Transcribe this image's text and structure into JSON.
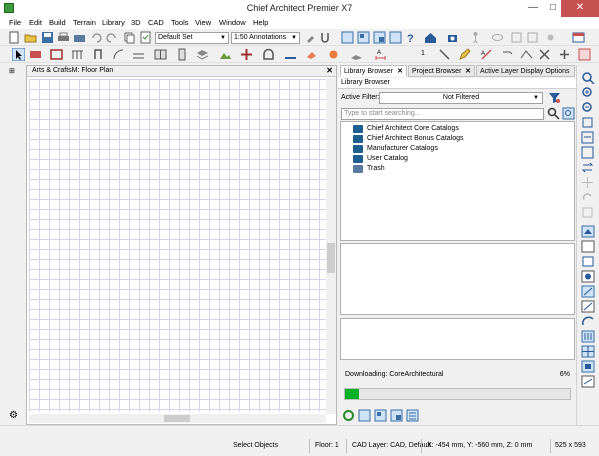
{
  "window": {
    "title": "Chief Architect Premier X7",
    "minimize": "—",
    "maximize": "□",
    "close": "✕"
  },
  "menu": [
    "File",
    "Edit",
    "Build",
    "Terrain",
    "Library",
    "3D",
    "CAD",
    "Tools",
    "View",
    "Window",
    "Help"
  ],
  "toolbar": {
    "layer_set": "Default Set",
    "annotation_set": "1:50 Annotations",
    "number_field": "1"
  },
  "plan_view": {
    "title": "Arts & CraftsM: Floor Plan",
    "close_label": "✕"
  },
  "library_panel": {
    "tabs": [
      {
        "label": "Library Browser",
        "close": "✕"
      },
      {
        "label": "Project Browser",
        "close": "✕"
      },
      {
        "label": "Active Layer Display Options",
        "close": ""
      }
    ],
    "header": "Library Browser",
    "active_filter_label": "Active Filter:",
    "active_filter_value": "Not Filtered",
    "search_placeholder": "Type to start searching...",
    "tree_items": [
      {
        "label": "Chief Architect Core Catalogs",
        "icon": "catalog-folder-icon"
      },
      {
        "label": "Chief Architect Bonus Catalogs",
        "icon": "catalog-folder-icon"
      },
      {
        "label": "Manufacturer Catalogs",
        "icon": "catalog-folder-icon"
      },
      {
        "label": "User Catalog",
        "icon": "folder-icon"
      },
      {
        "label": "Trash",
        "icon": "trash-icon"
      }
    ],
    "download_status": "Downloading:  CoreArchitectural",
    "download_percent_label": "6%",
    "download_progress": 0.06
  },
  "statusbar": {
    "mode": "Select Objects",
    "floor": "Floor: 1",
    "cad_layer": "CAD Layer:  CAD,  Default",
    "coordinates": "X: -454 mm, Y: -560 mm, Z: 0 mm",
    "canvas_size": "525 x 593"
  },
  "colors": {
    "progress_fill": "#06b025",
    "grid_line": "#d4d4ec",
    "close_button": "#c75050"
  }
}
